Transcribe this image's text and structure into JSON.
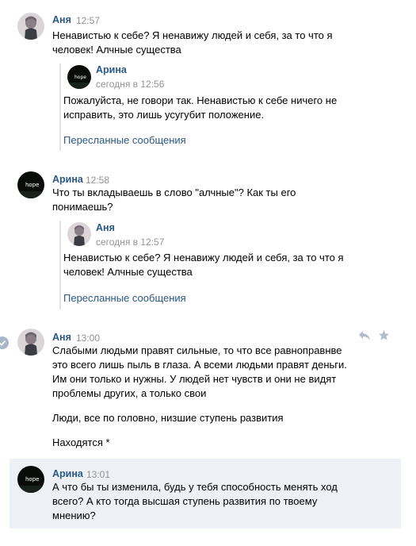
{
  "messages": [
    {
      "author": "Аня",
      "time": "12:57",
      "lines": [
        "Ненавистью к себе? Я ненавижу людей и себя, за то что я",
        "человек! Алчные существа"
      ],
      "forward": {
        "author": "Арина",
        "time": "сегодня в 12:56",
        "lines": [
          "Пожалуйста, не говори так. Ненавистью к себе ничего не",
          "исправить, это лишь усугубит положение."
        ],
        "link": "Пересланные сообщения"
      }
    },
    {
      "author": "Арина",
      "time": "12:58",
      "lines": [
        "Что ты вкладываешь в слово \"алчные\"? Как ты его",
        "понимаешь?"
      ],
      "forward": {
        "author": "Аня",
        "time": "сегодня в 12:57",
        "lines": [
          "Ненавистью к себе? Я ненавижу людей и себя, за то что я",
          "человек! Алчные существа"
        ],
        "link": "Пересланные сообщения"
      }
    },
    {
      "author": "Аня",
      "time": "13:00",
      "lines": [
        "Слабыми людьми правят сильные, то что все равноправнве",
        "это всего лишь пыль в глаза. А всеми людьми правят деньги.",
        "Им они только и нужны. У людей нет чувств и они не видят",
        "проблемы других, а только свои"
      ],
      "extra1": "Люди, все по головно, низшие ступень развития",
      "extra2": "Находятся *"
    },
    {
      "author": "Арина",
      "time": "13:01",
      "lines": [
        "А что бы ты изменила, будь у тебя способность менять ход",
        "всего? А кто тогда высшая ступень развития по твоему",
        "мнению?"
      ]
    }
  ],
  "avatar_text": "hope",
  "colors": {
    "author": "#2a5885",
    "time": "#939393",
    "selected_bg": "#edf0f5"
  }
}
